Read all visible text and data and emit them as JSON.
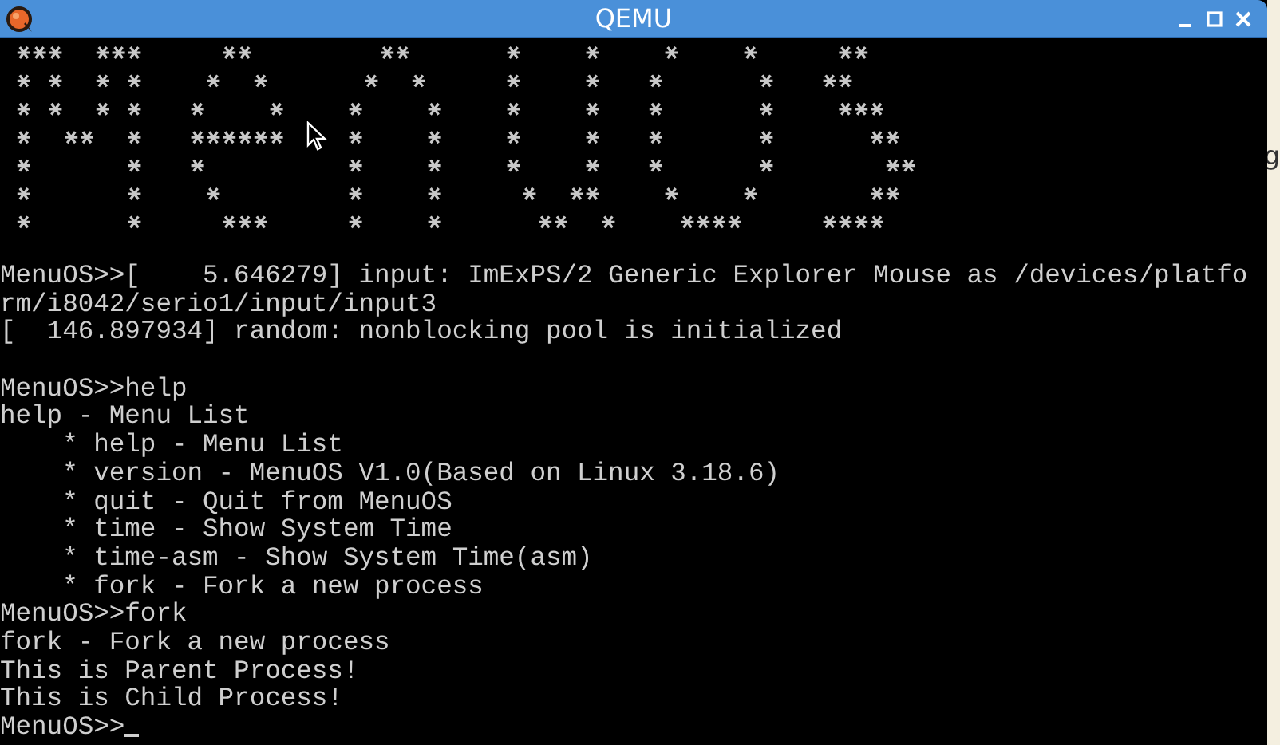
{
  "window": {
    "title": "QEMU"
  },
  "terminal": {
    "blocks": [
      [
        "MenuOS>>[    5.646279] input: ImExPS/2 Generic Explorer Mouse as /devices/platfo",
        "rm/i8042/serio1/input/input3",
        "[  146.897934] random: nonblocking pool is initialized"
      ],
      [
        "MenuOS>>help",
        "help - Menu List",
        "    * help - Menu List",
        "    * version - MenuOS V1.0(Based on Linux 3.18.6)",
        "    * quit - Quit from MenuOS",
        "    * time - Show System Time",
        "    * time-asm - Show System Time(asm)",
        "    * fork - Fork a new process",
        "MenuOS>>fork",
        "fork - Fork a new process",
        "This is Parent Process!",
        "This is Child Process!",
        "MenuOS>>"
      ]
    ],
    "cursor_visible": true
  },
  "desktop": {
    "edge_text": "g"
  }
}
